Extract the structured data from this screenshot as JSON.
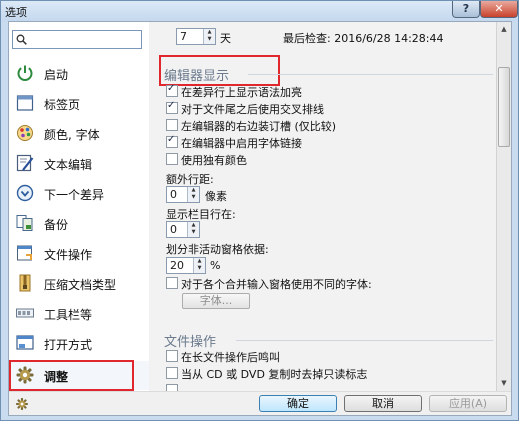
{
  "window": {
    "title": "选项"
  },
  "search": {
    "placeholder": "",
    "value": ""
  },
  "sidebar": {
    "items": [
      {
        "label": "启动",
        "icon": "power-icon"
      },
      {
        "label": "标签页",
        "icon": "tab-page-icon"
      },
      {
        "label": "颜色, 字体",
        "icon": "palette-icon"
      },
      {
        "label": "文本编辑",
        "icon": "text-edit-icon"
      },
      {
        "label": "下一个差异",
        "icon": "next-diff-icon"
      },
      {
        "label": "备份",
        "icon": "backup-icon"
      },
      {
        "label": "文件操作",
        "icon": "file-operation-icon"
      },
      {
        "label": "压缩文档类型",
        "icon": "archive-icon"
      },
      {
        "label": "工具栏等",
        "icon": "toolbar-icon"
      },
      {
        "label": "打开方式",
        "icon": "open-with-icon"
      },
      {
        "label": "调整",
        "icon": "gear-icon"
      }
    ],
    "selected": "调整"
  },
  "panel": {
    "update": {
      "days_value": "7",
      "days_unit": "天",
      "last_check": "最后检查: 2016/6/28 14:28:44"
    },
    "editor": {
      "title": "编辑器显示",
      "checks": [
        {
          "label": "在差异行上显示语法加亮",
          "checked": true
        },
        {
          "label": "对于文件尾之后使用交叉排线",
          "checked": true
        },
        {
          "label": "左编辑器的右边装订槽 (仅比较)",
          "checked": false
        },
        {
          "label": "在编辑器中启用字体链接",
          "checked": true
        },
        {
          "label": "使用独有颜色",
          "checked": false
        }
      ],
      "line_spacing": {
        "label": "额外行距:",
        "value": "0",
        "unit": "像素"
      },
      "show_columns": {
        "label": "显示栏目行在:",
        "value": "0"
      },
      "split": {
        "label": "划分非活动窗格依据:",
        "value": "20",
        "unit": "%"
      },
      "merge_font": {
        "label": "对于各个合并输入窗格使用不同的字体:",
        "checked": false,
        "button": "字体..."
      }
    },
    "file_ops": {
      "title": "文件操作",
      "checks": [
        {
          "label": "在长文件操作后鸣叫",
          "checked": false
        },
        {
          "label": "当从 CD 或 DVD 复制时去掉只读标志",
          "checked": false
        },
        {
          "label": "",
          "checked": false
        }
      ]
    }
  },
  "buttons": {
    "ok": "确定",
    "cancel": "取消",
    "apply": "应用(A)"
  },
  "titlebar": {
    "help": "?",
    "close": "✕"
  },
  "colors": {
    "highlight_box": "#e0272d",
    "title_bar": "#c8dbef",
    "section_title": "#6b7a8d"
  }
}
